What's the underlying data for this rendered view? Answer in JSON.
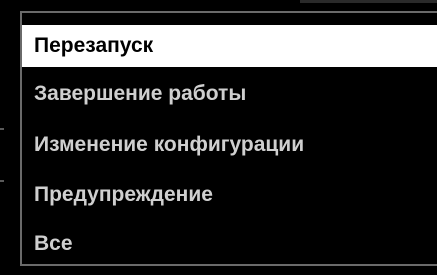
{
  "menu": {
    "items": [
      {
        "label": "Перезапуск",
        "selected": true
      },
      {
        "label": "Завершение работы",
        "selected": false
      },
      {
        "label": "Изменение конфигурации",
        "selected": false
      },
      {
        "label": "Предупреждение",
        "selected": false
      },
      {
        "label": "Все",
        "selected": false
      }
    ]
  },
  "colors": {
    "background": "#000000",
    "text": "#cfcfcf",
    "selected_background": "#ffffff",
    "selected_text": "#000000",
    "border": "#6a6a6a"
  }
}
